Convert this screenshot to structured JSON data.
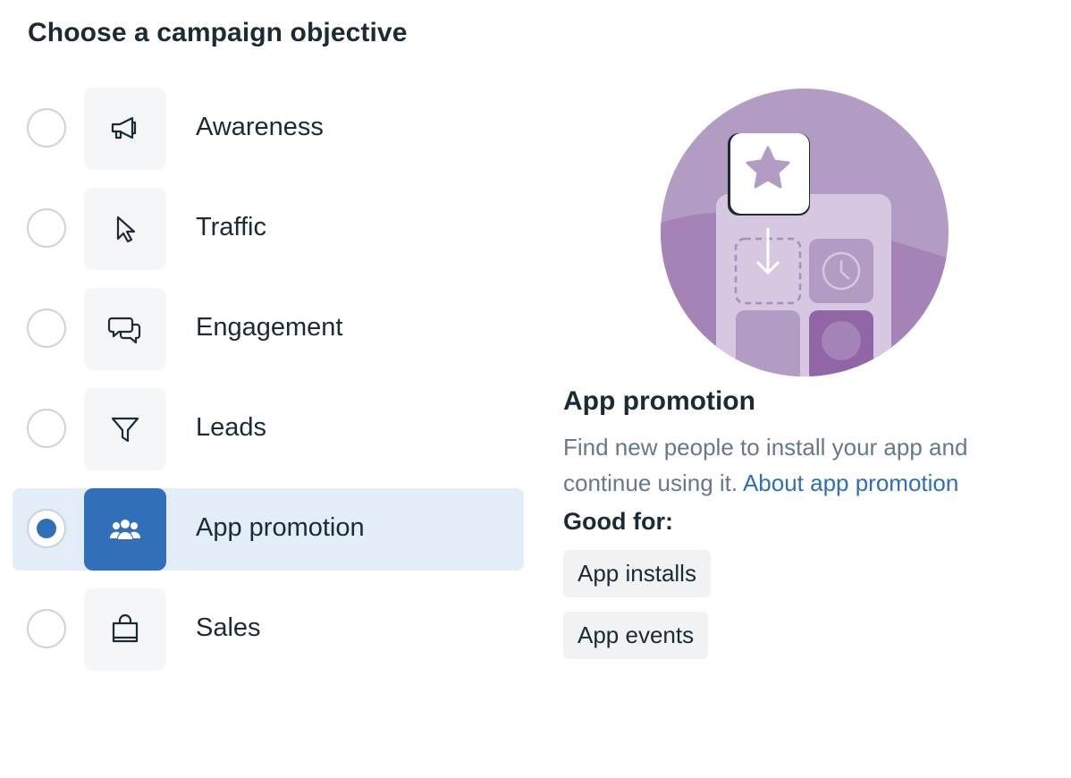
{
  "page": {
    "title": "Choose a campaign objective"
  },
  "objectives": [
    {
      "label": "Awareness",
      "icon": "megaphone-icon",
      "selected": false
    },
    {
      "label": "Traffic",
      "icon": "cursor-icon",
      "selected": false
    },
    {
      "label": "Engagement",
      "icon": "chat-bubbles-icon",
      "selected": false
    },
    {
      "label": "Leads",
      "icon": "funnel-icon",
      "selected": false
    },
    {
      "label": "App promotion",
      "icon": "people-group-icon",
      "selected": true
    },
    {
      "label": "Sales",
      "icon": "shopping-bag-icon",
      "selected": false
    }
  ],
  "detail": {
    "title": "App promotion",
    "description": "Find new people to install your app and continue using it.",
    "link_text": "About app promotion",
    "good_for_label": "Good for:",
    "chips": [
      "App installs",
      "App events"
    ]
  },
  "colors": {
    "accent": "#3170b8",
    "selected_row_bg": "#e3edf7",
    "illustration_purple": "#b39cc3"
  }
}
